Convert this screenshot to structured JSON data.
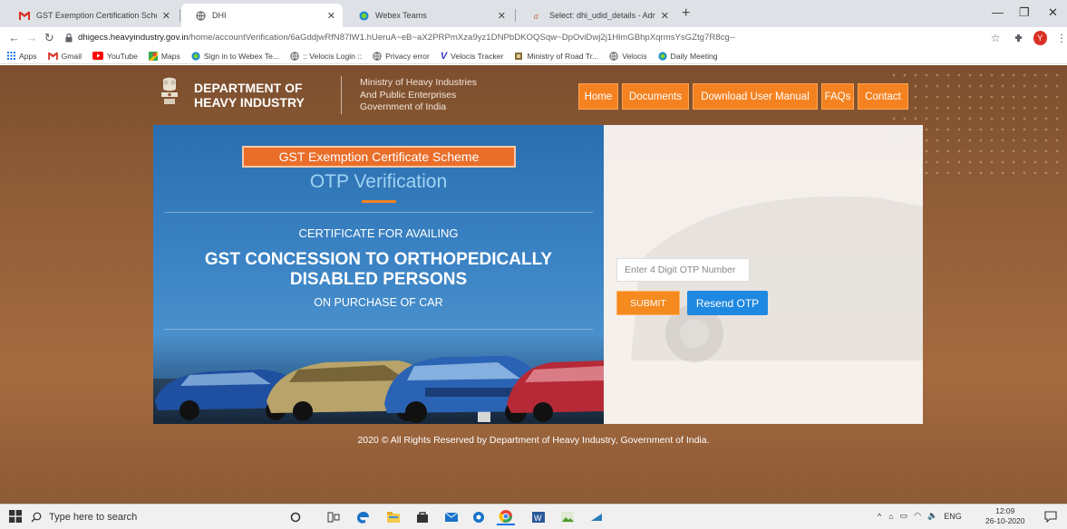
{
  "browser": {
    "tabs": [
      {
        "title": "GST Exemption Certification Sche",
        "icon": "gmail-icon"
      },
      {
        "title": "DHI",
        "icon": "globe-icon",
        "active": true
      },
      {
        "title": "Webex Teams",
        "icon": "webex-icon"
      },
      {
        "title": "Select: dhi_udid_details - Admini",
        "icon": "app-icon"
      }
    ],
    "url_domain": "dhigecs.heavyindustry.gov.in",
    "url_path": "/home/accountVerification/6aGddjwRfN87lW1.hUeruA~eB~aX2PRPmXza9yz1DNPbDKOQSqw~DpOviDwj2j1HlmGBhpXqrmsYsGZtg7R8cg--",
    "profile_initial": "Y",
    "bookmarks": [
      {
        "label": "Apps",
        "icon": "apps-grid-icon"
      },
      {
        "label": "Gmail",
        "icon": "gmail-icon"
      },
      {
        "label": "YouTube",
        "icon": "youtube-icon"
      },
      {
        "label": "Maps",
        "icon": "maps-icon"
      },
      {
        "label": "Sign in to Webex Te...",
        "icon": "webex-icon"
      },
      {
        "label": ":: Velocis Login ::",
        "icon": "globe-icon"
      },
      {
        "label": "Privacy error",
        "icon": "globe-icon"
      },
      {
        "label": "Velocis Tracker",
        "icon": "velocis-v-icon"
      },
      {
        "label": "Ministry of Road Tr...",
        "icon": "ministry-icon"
      },
      {
        "label": "Velocis",
        "icon": "globe-icon"
      },
      {
        "label": "Daily Meeting",
        "icon": "webex-icon"
      }
    ]
  },
  "site": {
    "dept_line1": "DEPARTMENT OF",
    "dept_line2": "HEAVY INDUSTRY",
    "ministry_line1": "Ministry of Heavy Industries",
    "ministry_line2": "And Public Enterprises",
    "ministry_line3": "Government of India",
    "nav": [
      "Home",
      "Documents",
      "Download User Manual",
      "FAQs",
      "Contact"
    ],
    "scheme_title": "GST Exemption Certificate Scheme",
    "page_title": "OTP Verification",
    "cert_line1": "CERTIFICATE FOR AVAILING",
    "cert_line2a": "GST CONCESSION TO ORTHOPEDICALLY",
    "cert_line2b": "DISABLED PERSONS",
    "cert_line3": "ON PURCHASE OF CAR",
    "otp_placeholder": "Enter 4 Digit OTP Number",
    "submit_label": "SUBMIT",
    "resend_label": "Resend OTP",
    "footer": "2020 © All Rights Reserved by Department of Heavy Industry, Government of India."
  },
  "taskbar": {
    "search_placeholder": "Type here to search",
    "lang": "ENG",
    "time": "12:09",
    "date": "26-10-2020"
  },
  "colors": {
    "accent_orange": "#f58220",
    "resend_blue": "#1f88e0",
    "page_brown": "#8c5a36"
  }
}
